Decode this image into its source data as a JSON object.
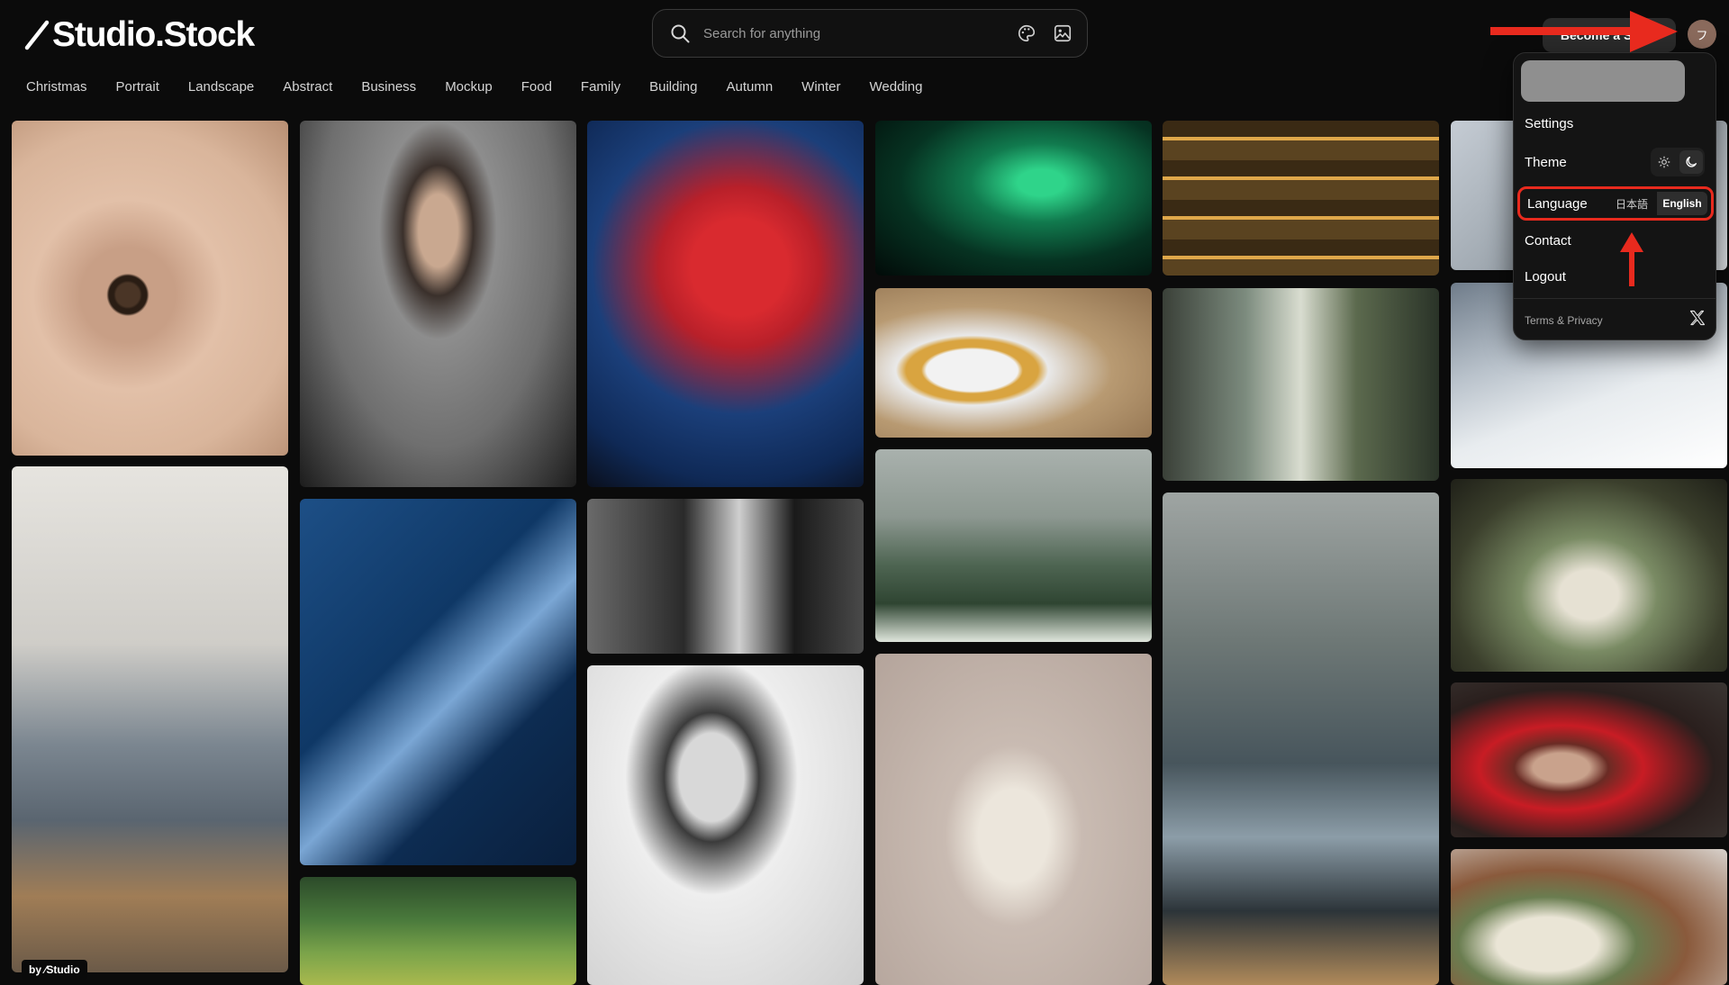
{
  "brand": {
    "logo_text": "Studio.Stock"
  },
  "search": {
    "placeholder": "Search for anything"
  },
  "header": {
    "become_label": "Become a Seller",
    "avatar_initial": "フ"
  },
  "categories": [
    "Christmas",
    "Portrait",
    "Landscape",
    "Abstract",
    "Business",
    "Mockup",
    "Food",
    "Family",
    "Building",
    "Autumn",
    "Winter",
    "Wedding"
  ],
  "menu": {
    "settings": "Settings",
    "theme": "Theme",
    "language": "Language",
    "lang_ja": "日本語",
    "lang_en": "English",
    "contact": "Contact",
    "logout": "Logout",
    "terms": "Terms & Privacy"
  },
  "badge": {
    "text": "by ⁄Studio"
  },
  "photos": [
    {
      "name": "photo-eye-closeup"
    },
    {
      "name": "photo-warehouse-worker"
    },
    {
      "name": "photo-portrait-woman-black"
    },
    {
      "name": "photo-portrait-man-blue"
    },
    {
      "name": "photo-meadow-green"
    },
    {
      "name": "photo-red-maple"
    },
    {
      "name": "photo-woman-bw-profile"
    },
    {
      "name": "photo-woman-laughing-bw"
    },
    {
      "name": "photo-green-abstract-smoke"
    },
    {
      "name": "photo-tempura-food"
    },
    {
      "name": "photo-woman-flower-field"
    },
    {
      "name": "photo-woman-white-outfit"
    },
    {
      "name": "photo-bookshelf-woman"
    },
    {
      "name": "photo-flower-shop"
    },
    {
      "name": "photo-delivery-driver"
    },
    {
      "name": "photo-snowboarder"
    },
    {
      "name": "photo-florist-arranging"
    },
    {
      "name": "photo-woman-red-kimono"
    },
    {
      "name": "photo-bouquet-hair"
    }
  ],
  "colors": {
    "background": "#0b0b0b",
    "accent_red": "#e82a1e",
    "menu_bg": "#141414"
  }
}
